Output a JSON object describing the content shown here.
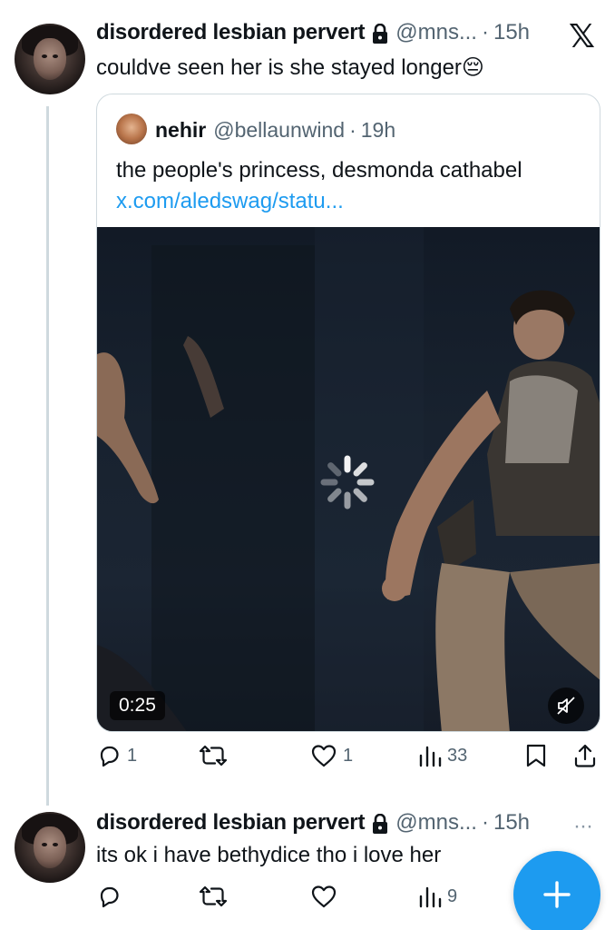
{
  "header": {
    "close_icon": "x-logo",
    "close_label": "𝕏"
  },
  "tweet1": {
    "author_name": "disordered lesbian pervert",
    "handle": "@mns...",
    "separator": "·",
    "time": "15h",
    "text": "couldve seen her is she stayed longer😔",
    "quote": {
      "author_name": "nehir",
      "handle": "@bellaunwind",
      "separator": "·",
      "time": "19h",
      "text": "the people's princess, desmonda cathabel",
      "link": "x.com/aledswag/statu...",
      "video": {
        "duration": "0:25",
        "muted": true,
        "loading": true
      }
    },
    "actions": {
      "replies": "1",
      "reposts": "",
      "likes": "1",
      "views": "33"
    }
  },
  "tweet2": {
    "author_name": "disordered lesbian pervert",
    "handle": "@mns...",
    "separator": "·",
    "time": "15h",
    "text": "its ok i have bethydice tho i love her",
    "more": "···",
    "actions": {
      "replies": "",
      "reposts": "",
      "likes": "",
      "views": "9"
    }
  },
  "compose": {
    "label": "+"
  },
  "colors": {
    "accent": "#1d9bf0",
    "muted": "#536471",
    "border": "#cfd9de"
  }
}
